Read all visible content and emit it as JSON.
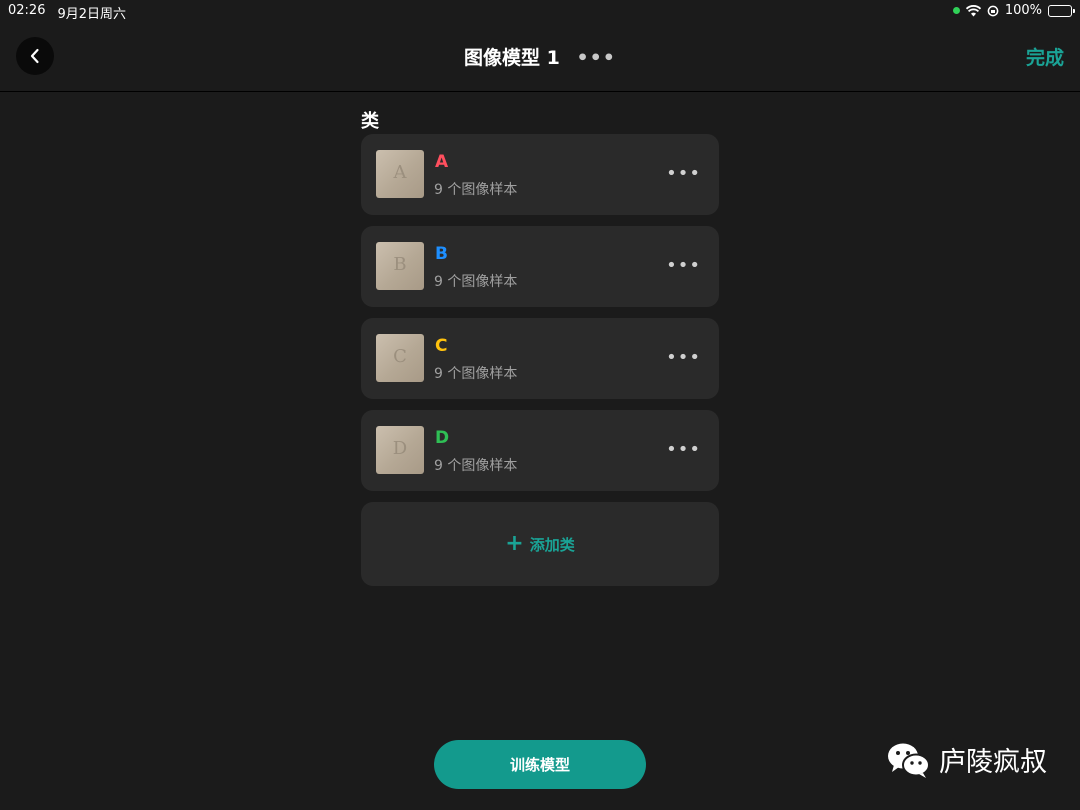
{
  "status_bar": {
    "time": "02:26",
    "date": "9月2日周六",
    "battery": "100%"
  },
  "nav": {
    "back_icon": "chevron-left-icon",
    "title": "图像模型 1",
    "more_icon": "ellipsis-icon",
    "done_label": "完成"
  },
  "section": {
    "label": "类"
  },
  "classes": [
    {
      "name": "A",
      "color": "#ff4f5e",
      "thumb_letter": "A",
      "samples": "9 个图像样本"
    },
    {
      "name": "B",
      "color": "#1e8fff",
      "thumb_letter": "B",
      "samples": "9 个图像样本"
    },
    {
      "name": "C",
      "color": "#ffc20e",
      "thumb_letter": "C",
      "samples": "9 个图像样本"
    },
    {
      "name": "D",
      "color": "#2fbf55",
      "thumb_letter": "D",
      "samples": "9 个图像样本"
    }
  ],
  "add_class": {
    "icon": "plus-icon",
    "label": "添加类"
  },
  "train_button": {
    "label": "训练模型"
  },
  "watermark": {
    "icon": "wechat-icon",
    "text": "庐陵疯叔"
  },
  "colors": {
    "accent": "#1aa396",
    "background": "#1b1b1b",
    "card": "#2a2a2a"
  }
}
